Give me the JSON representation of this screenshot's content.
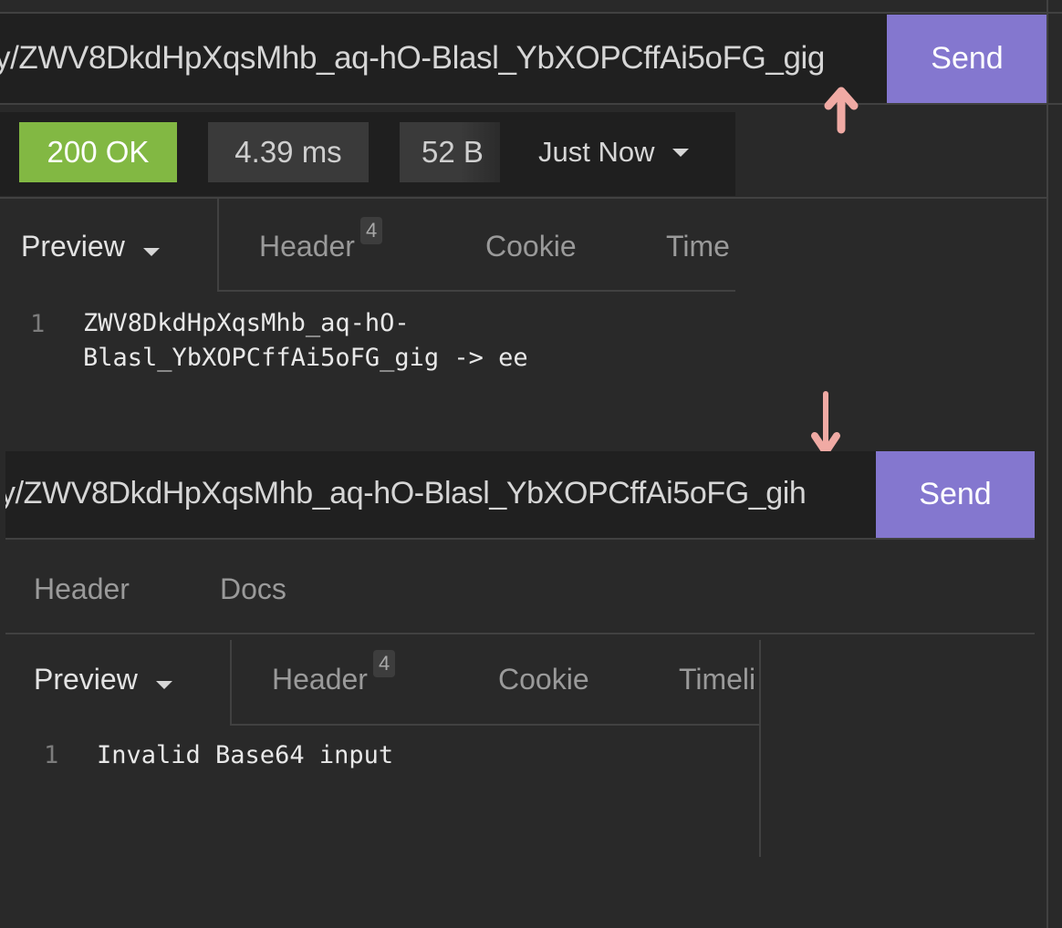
{
  "panel_top": {
    "request": {
      "url_visible": "y/ZWV8DkdHpXqsMhb_aq-hO-Blasl_YbXOPCffAi5oFG_gig",
      "send_label": "Send"
    },
    "response_meta": {
      "status": "200 OK",
      "status_color": "#82b843",
      "time": "4.39 ms",
      "size": "52 B",
      "history_label": "Just Now"
    },
    "response_tabs": [
      {
        "label": "Preview",
        "active": true,
        "has_dropdown": true
      },
      {
        "label": "Header",
        "badge": "4"
      },
      {
        "label": "Cookie"
      },
      {
        "label": "Time"
      }
    ],
    "response_body": {
      "line_numbers": [
        "1"
      ],
      "lines": [
        "ZWV8DkdHpXqsMhb_aq-hO-",
        "Blasl_YbXOPCffAi5oFG_gig -> ee"
      ]
    }
  },
  "panel_bottom": {
    "request": {
      "url_visible": "y/ZWV8DkdHpXqsMhb_aq-hO-Blasl_YbXOPCffAi5oFG_gih",
      "send_label": "Send"
    },
    "request_tabs": [
      {
        "label": "Header"
      },
      {
        "label": "Docs"
      }
    ],
    "response_tabs": [
      {
        "label": "Preview",
        "active": true,
        "has_dropdown": true
      },
      {
        "label": "Header",
        "badge": "4"
      },
      {
        "label": "Cookie"
      },
      {
        "label": "Timeli"
      }
    ],
    "response_body": {
      "line_numbers": [
        "1"
      ],
      "lines": [
        "Invalid Base64 input"
      ]
    }
  },
  "annotations": {
    "arrow_color": "#f0aaa4",
    "arrow_up": "up-arrow",
    "arrow_down": "down-arrow"
  },
  "colors": {
    "accent": "#8477cf",
    "background": "#292929",
    "input_bg": "#202020"
  }
}
